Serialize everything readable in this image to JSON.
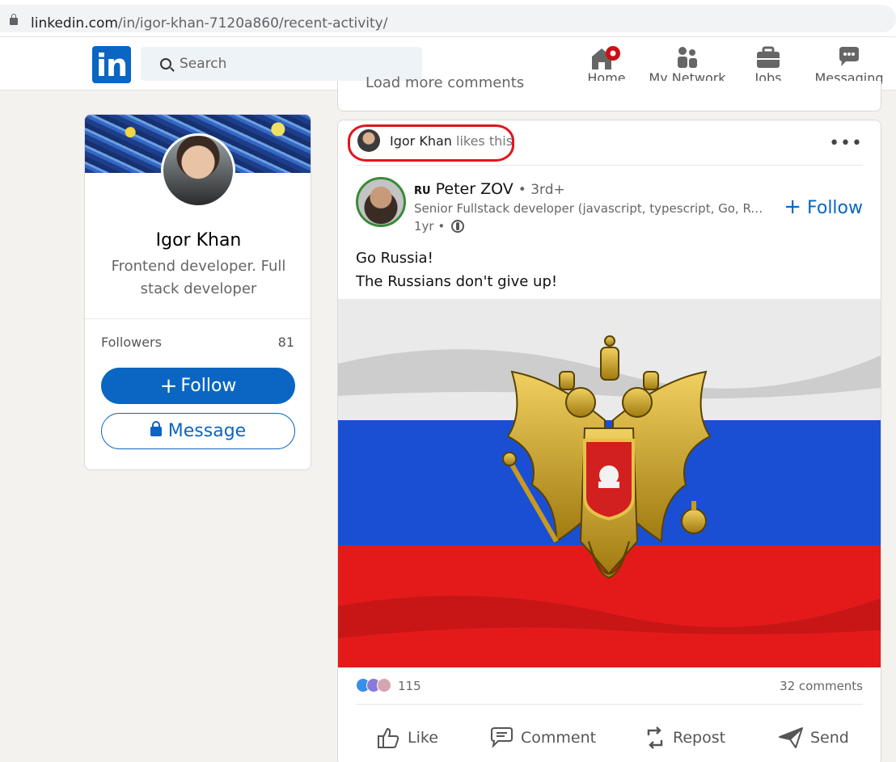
{
  "browser": {
    "url_host": "linkedin.com",
    "url_path": "/in/igor-khan-7120a860/recent-activity/"
  },
  "nav": {
    "logo": "in",
    "search_placeholder": "Search",
    "items": [
      {
        "label": "Home"
      },
      {
        "label": "My Network"
      },
      {
        "label": "Jobs"
      },
      {
        "label": "Messaging"
      }
    ]
  },
  "profile": {
    "name": "Igor Khan",
    "headline": "Frontend developer. Full stack developer",
    "followers_label": "Followers",
    "followers_count": "81",
    "follow_label": "Follow",
    "message_label": "Message"
  },
  "prev_card": {
    "load_more": "Load more comments"
  },
  "post": {
    "activity_actor": "Igor Khan",
    "activity_text": "likes this",
    "more": "•••",
    "author": {
      "flag": "RU",
      "name": "Peter ZOV",
      "degree": "• 3rd+",
      "headline": "Senior Fullstack developer (javascript, typescript, Go, Rust, Python)",
      "time": "1yr •"
    },
    "follow_label": "Follow",
    "text_line1": "Go Russia!",
    "text_line2": "The Russians don't give up!",
    "reactions_count": "115",
    "comments_count": "32 comments",
    "actions": [
      {
        "label": "Like"
      },
      {
        "label": "Comment"
      },
      {
        "label": "Repost"
      },
      {
        "label": "Send"
      }
    ]
  },
  "colors": {
    "linkedin_blue": "#0a66c2",
    "highlight_red": "#e0161c"
  }
}
